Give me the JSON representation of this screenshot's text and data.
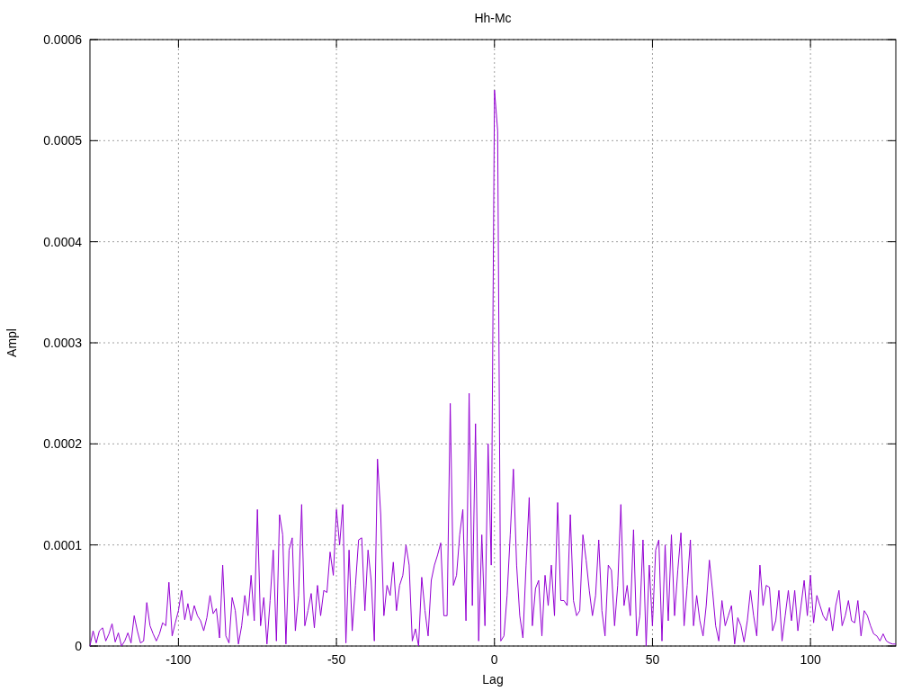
{
  "chart_data": {
    "type": "line",
    "title": "Hh-Mc",
    "xlabel": "Lag",
    "ylabel": "Ampl",
    "grid": true,
    "xlim": [
      -128,
      127
    ],
    "ylim": [
      0,
      0.0006
    ],
    "x": [
      -128,
      -127,
      -126,
      -125,
      -124,
      -123,
      -122,
      -121,
      -120,
      -119,
      -118,
      -117,
      -116,
      -115,
      -114,
      -113,
      -112,
      -111,
      -110,
      -109,
      -108,
      -107,
      -106,
      -105,
      -104,
      -103,
      -102,
      -101,
      -100,
      -99,
      -98,
      -97,
      -96,
      -95,
      -94,
      -93,
      -92,
      -91,
      -90,
      -89,
      -88,
      -87,
      -86,
      -85,
      -84,
      -83,
      -82,
      -81,
      -80,
      -79,
      -78,
      -77,
      -76,
      -75,
      -74,
      -73,
      -72,
      -71,
      -70,
      -69,
      -68,
      -67,
      -66,
      -65,
      -64,
      -63,
      -62,
      -61,
      -60,
      -59,
      -58,
      -57,
      -56,
      -55,
      -54,
      -53,
      -52,
      -51,
      -50,
      -49,
      -48,
      -47,
      -46,
      -45,
      -44,
      -43,
      -42,
      -41,
      -40,
      -39,
      -38,
      -37,
      -36,
      -35,
      -34,
      -33,
      -32,
      -31,
      -30,
      -29,
      -28,
      -27,
      -26,
      -25,
      -24,
      -23,
      -22,
      -21,
      -20,
      -19,
      -18,
      -17,
      -16,
      -15,
      -14,
      -13,
      -12,
      -11,
      -10,
      -9,
      -8,
      -7,
      -6,
      -5,
      -4,
      -3,
      -2,
      -1,
      0,
      1,
      2,
      3,
      4,
      5,
      6,
      7,
      8,
      9,
      10,
      11,
      12,
      13,
      14,
      15,
      16,
      17,
      18,
      19,
      20,
      21,
      22,
      23,
      24,
      25,
      26,
      27,
      28,
      29,
      30,
      31,
      32,
      33,
      34,
      35,
      36,
      37,
      38,
      39,
      40,
      41,
      42,
      43,
      44,
      45,
      46,
      47,
      48,
      49,
      50,
      51,
      52,
      53,
      54,
      55,
      56,
      57,
      58,
      59,
      60,
      61,
      62,
      63,
      64,
      65,
      66,
      67,
      68,
      69,
      70,
      71,
      72,
      73,
      74,
      75,
      76,
      77,
      78,
      79,
      80,
      81,
      82,
      83,
      84,
      85,
      86,
      87,
      88,
      89,
      90,
      91,
      92,
      93,
      94,
      95,
      96,
      97,
      98,
      99,
      100,
      101,
      102,
      103,
      104,
      105,
      106,
      107,
      108,
      109,
      110,
      111,
      112,
      113,
      114,
      115,
      116,
      117,
      118,
      119,
      120,
      121,
      122,
      123,
      124,
      125,
      126,
      127
    ],
    "xticks": [
      -100,
      -50,
      0,
      50,
      100
    ],
    "yticks": [
      {
        "value": 0,
        "label": "0"
      },
      {
        "value": 0.0001,
        "label": "0.0001"
      },
      {
        "value": 0.0002,
        "label": "0.0002"
      },
      {
        "value": 0.0003,
        "label": "0.0003"
      },
      {
        "value": 0.0004,
        "label": "0.0004"
      },
      {
        "value": 0.0005,
        "label": "0.0005"
      },
      {
        "value": 0.0006,
        "label": "0.0006"
      }
    ],
    "series": [
      {
        "color": "#9400d3",
        "values": [
          0,
          1.5e-05,
          3e-06,
          1.5e-05,
          1.8e-05,
          5e-06,
          1.2e-05,
          2.2e-05,
          4e-06,
          1.3e-05,
          0,
          5e-06,
          1.3e-05,
          3e-06,
          3e-05,
          1.5e-05,
          3e-06,
          5e-06,
          4.3e-05,
          2e-05,
          1.2e-05,
          5e-06,
          1.2e-05,
          2.3e-05,
          2e-05,
          6.3e-05,
          1e-05,
          2.3e-05,
          3.5e-05,
          5.5e-05,
          2.6e-05,
          4.2e-05,
          2.5e-05,
          4e-05,
          3e-05,
          2.5e-05,
          1.5e-05,
          2.8e-05,
          5e-05,
          3.2e-05,
          3.7e-05,
          8e-06,
          8e-05,
          1e-05,
          3e-06,
          4.8e-05,
          3.5e-05,
          2e-06,
          2e-05,
          5e-05,
          3e-05,
          7e-05,
          2.5e-05,
          0.000135,
          2e-05,
          4.8e-05,
          2e-06,
          4.5e-05,
          9.5e-05,
          5e-06,
          0.00013,
          0.00011,
          2e-06,
          9.5e-05,
          0.000107,
          1.5e-05,
          5e-05,
          0.00014,
          2e-05,
          3.5e-05,
          5.2e-05,
          1.8e-05,
          6e-05,
          3e-05,
          5.5e-05,
          5.3e-05,
          9.3e-05,
          7e-05,
          0.000135,
          0.0001,
          0.00014,
          3e-06,
          9.5e-05,
          1.5e-05,
          6e-05,
          0.000105,
          0.000107,
          3.5e-05,
          9.5e-05,
          6.5e-05,
          5e-06,
          0.000185,
          0.00013,
          3e-05,
          6e-05,
          5e-05,
          8.3e-05,
          3.5e-05,
          6e-05,
          7e-05,
          0.0001,
          8e-05,
          5e-06,
          1.7e-05,
          0,
          6.8e-05,
          3.5e-05,
          1e-05,
          6.5e-05,
          8e-05,
          9e-05,
          0.000102,
          3e-05,
          3e-05,
          0.00024,
          6e-05,
          7e-05,
          0.00011,
          0.000135,
          2.5e-05,
          0.00025,
          4e-05,
          0.00022,
          5e-06,
          0.00011,
          2e-05,
          0.0002,
          8e-05,
          0.00055,
          0.00051,
          5e-06,
          1e-05,
          5e-05,
          0.00011,
          0.000175,
          8e-05,
          3e-05,
          8e-06,
          8e-05,
          0.000147,
          2e-05,
          5.7e-05,
          6.5e-05,
          1e-05,
          7e-05,
          4e-05,
          8e-05,
          3e-05,
          0.000142,
          4.5e-05,
          4.5e-05,
          4e-05,
          0.00013,
          4.5e-05,
          3e-05,
          3.5e-05,
          0.00011,
          8.5e-05,
          5.5e-05,
          3e-05,
          5e-05,
          0.000105,
          3.5e-05,
          1e-05,
          8e-05,
          7.5e-05,
          2e-05,
          6e-05,
          0.00014,
          4e-05,
          6e-05,
          3e-05,
          0.000115,
          1e-05,
          3e-05,
          0.000105,
          0,
          8e-05,
          2e-05,
          9.5e-05,
          0.000105,
          5e-06,
          0.0001,
          2.5e-05,
          0.00011,
          3e-05,
          7.5e-05,
          0.000112,
          2e-05,
          6e-05,
          0.000105,
          2e-05,
          5e-05,
          2.5e-05,
          1e-05,
          4e-05,
          8.5e-05,
          5.5e-05,
          2e-05,
          5e-06,
          4.5e-05,
          2e-05,
          3e-05,
          4e-05,
          2e-06,
          2.8e-05,
          2e-05,
          4e-06,
          2.5e-05,
          5.5e-05,
          3e-05,
          1e-05,
          8e-05,
          4e-05,
          6e-05,
          5.8e-05,
          1.5e-05,
          2.5e-05,
          5.5e-05,
          5e-06,
          3e-05,
          5.5e-05,
          2.5e-05,
          5.5e-05,
          1.5e-05,
          4e-05,
          6.5e-05,
          3e-05,
          7e-05,
          2.3e-05,
          5e-05,
          4e-05,
          3e-05,
          2.5e-05,
          3.8e-05,
          1.5e-05,
          4e-05,
          5.5e-05,
          2e-05,
          3e-05,
          4.5e-05,
          2.5e-05,
          2.3e-05,
          4.5e-05,
          1e-05,
          3.5e-05,
          3e-05,
          2e-05,
          1.2e-05,
          1e-05,
          5e-06,
          1.2e-05,
          5e-06,
          3e-06,
          2e-06,
          2e-06
        ]
      }
    ]
  }
}
